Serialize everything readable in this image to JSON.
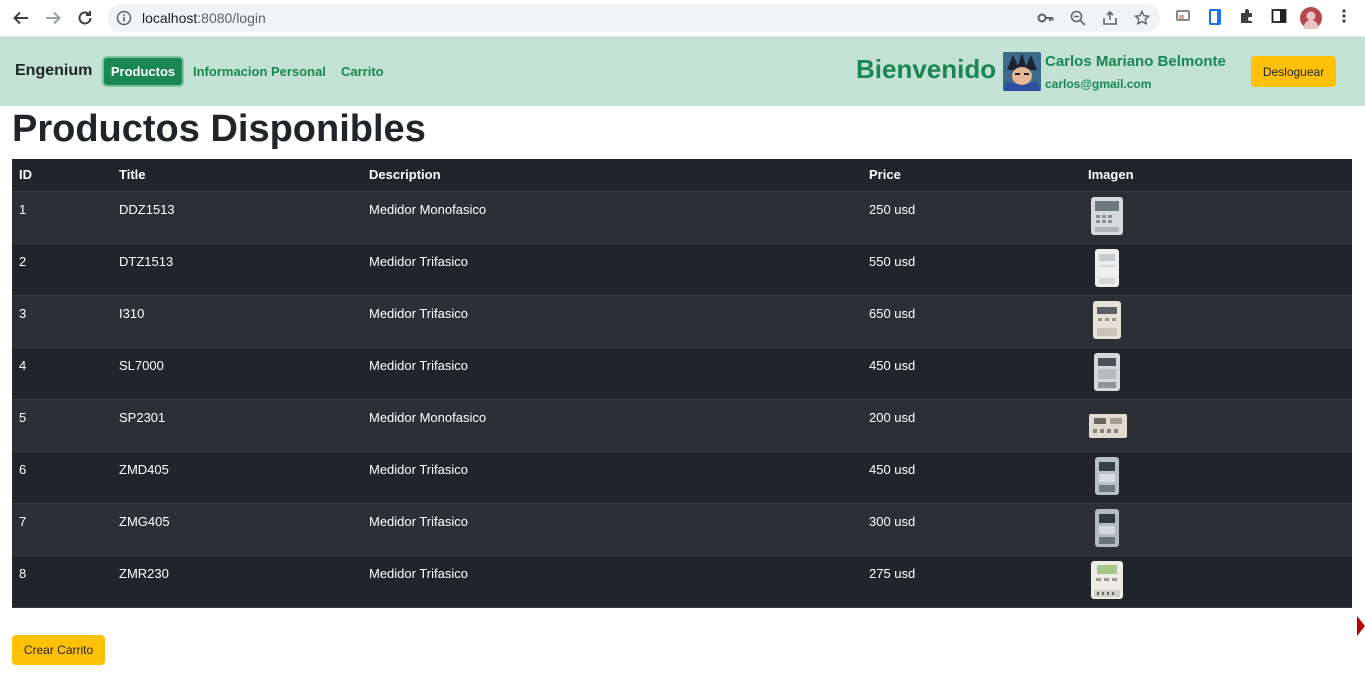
{
  "browser": {
    "url_host": "localhost",
    "url_rest": ":8080/login",
    "icons": [
      "back-icon",
      "forward-icon",
      "reload-icon",
      "info-icon",
      "key-icon",
      "zoom-icon",
      "share-icon",
      "star-icon",
      "cast-icon",
      "extension-doc-icon",
      "puzzle-icon",
      "sidepanel-icon",
      "profile-avatar",
      "menu-dots-icon"
    ]
  },
  "navbar": {
    "brand": "Engenium",
    "links": [
      {
        "label": "Productos",
        "active": true
      },
      {
        "label": "Informacion Personal",
        "active": false
      },
      {
        "label": "Carrito",
        "active": false
      }
    ],
    "welcome": "Bienvenido",
    "user_name": "Carlos Mariano Belmonte",
    "user_email": "carlos@gmail.com",
    "logout_label": "Desloguear"
  },
  "main": {
    "title": "Productos Disponibles",
    "table": {
      "headers": [
        "ID",
        "Title",
        "Description",
        "Price",
        "Imagen"
      ],
      "rows": [
        {
          "id": "1",
          "title": "DDZ1513",
          "description": "Medidor Monofasico",
          "price": "250 usd",
          "image": "meter-icon"
        },
        {
          "id": "2",
          "title": "DTZ1513",
          "description": "Medidor Trifasico",
          "price": "550 usd",
          "image": "meter-icon"
        },
        {
          "id": "3",
          "title": "I310",
          "description": "Medidor Trifasico",
          "price": "650 usd",
          "image": "meter-icon"
        },
        {
          "id": "4",
          "title": "SL7000",
          "description": "Medidor Trifasico",
          "price": "450 usd",
          "image": "meter-icon"
        },
        {
          "id": "5",
          "title": "SP2301",
          "description": "Medidor Monofasico",
          "price": "200 usd",
          "image": "meter-icon"
        },
        {
          "id": "6",
          "title": "ZMD405",
          "description": "Medidor Trifasico",
          "price": "450 usd",
          "image": "meter-icon"
        },
        {
          "id": "7",
          "title": "ZMG405",
          "description": "Medidor Trifasico",
          "price": "300 usd",
          "image": "meter-icon"
        },
        {
          "id": "8",
          "title": "ZMR230",
          "description": "Medidor Trifasico",
          "price": "275 usd",
          "image": "meter-icon"
        }
      ]
    },
    "create_cart_label": "Crear Carrito"
  },
  "colors": {
    "navbar_bg": "#c3e2d4",
    "accent_green": "#198754",
    "warning_yellow": "#ffc107",
    "table_dark": "#212529",
    "table_striped": "#2c3034"
  }
}
